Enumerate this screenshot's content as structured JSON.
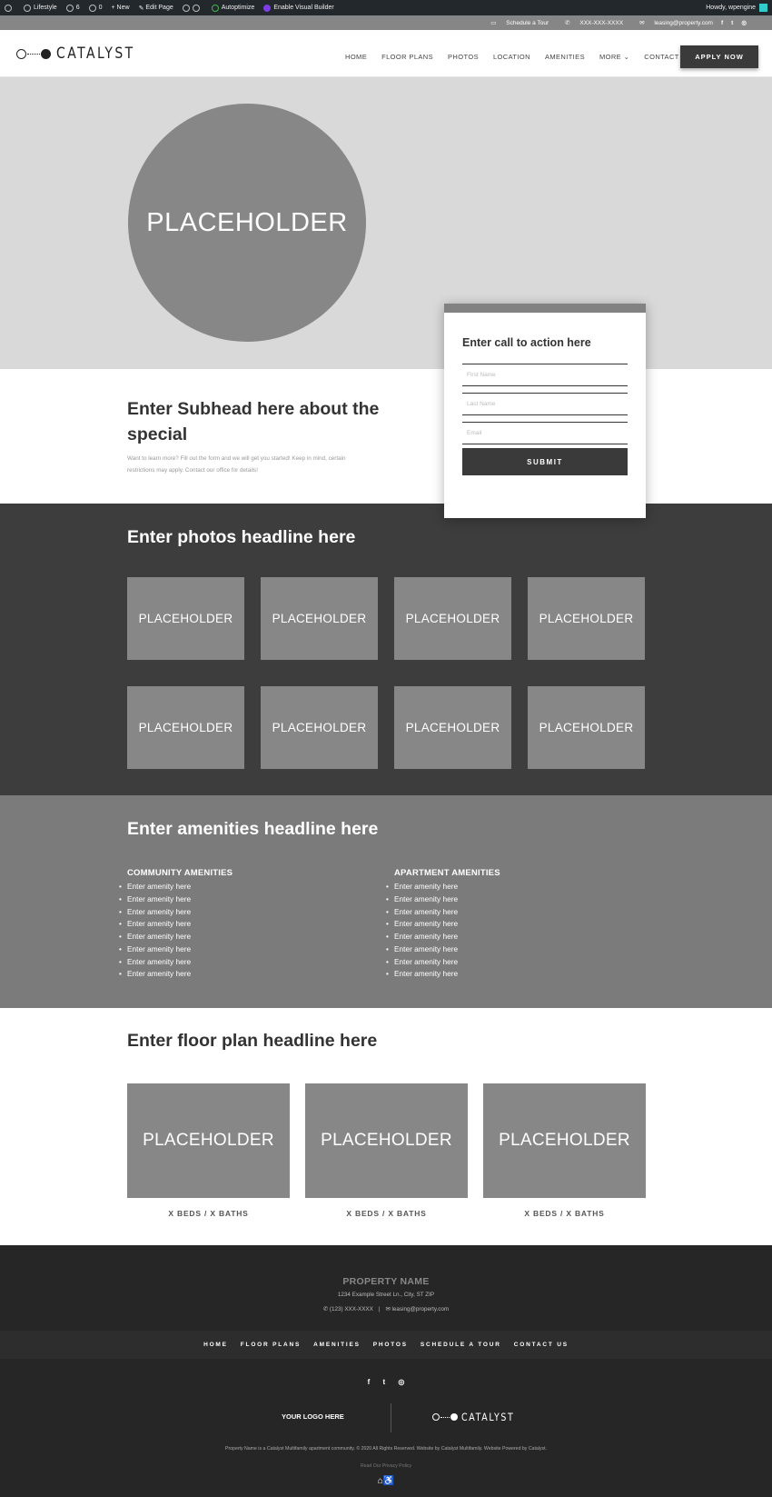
{
  "admin_bar": {
    "site": "Lifestyle",
    "updates": "6",
    "comments": "0",
    "new": "New",
    "edit_page": "Edit Page",
    "autoptimize": "Autoptimize",
    "visual_builder": "Enable Visual Builder",
    "howdy": "Howdy, wpengine"
  },
  "top_bar": {
    "schedule": "Schedule a Tour",
    "phone": "XXX-XXX-XXXX",
    "email": "leasing@property.com"
  },
  "header": {
    "logo_text": "CATALYST",
    "nav": [
      "HOME",
      "FLOOR PLANS",
      "PHOTOS",
      "LOCATION",
      "AMENITIES",
      "MORE ⌄",
      "CONTACT US"
    ],
    "apply_label": "APPLY NOW"
  },
  "hero": {
    "placeholder": "PLACEHOLDER"
  },
  "special": {
    "subhead": "Enter Subhead here about the special",
    "body": "Want to learn more? Fill out the form and we will get you started! Keep in mind, certain restrictions may apply. Contact our office for details!"
  },
  "cta": {
    "title": "Enter call to action here",
    "first_name_placeholder": "First Name",
    "last_name_placeholder": "Last Name",
    "email_placeholder": "Email",
    "submit_label": "SUBMIT"
  },
  "photos": {
    "headline": "Enter photos headline here",
    "items": [
      "PLACEHOLDER",
      "PLACEHOLDER",
      "PLACEHOLDER",
      "PLACEHOLDER",
      "PLACEHOLDER",
      "PLACEHOLDER",
      "PLACEHOLDER",
      "PLACEHOLDER"
    ]
  },
  "amenities": {
    "headline": "Enter amenities headline here",
    "community_title": "COMMUNITY AMENITIES",
    "apartment_title": "APARTMENT AMENITIES",
    "community": [
      "Enter amenity here",
      "Enter amenity here",
      "Enter amenity here",
      "Enter amenity here",
      "Enter amenity here",
      "Enter amenity here",
      "Enter amenity here",
      "Enter amenity here"
    ],
    "apartment": [
      "Enter amenity here",
      "Enter amenity here",
      "Enter amenity here",
      "Enter amenity here",
      "Enter amenity here",
      "Enter amenity here",
      "Enter amenity here",
      "Enter amenity here"
    ]
  },
  "floor_plans": {
    "headline": "Enter floor plan headline here",
    "items": [
      {
        "label": "PLACEHOLDER",
        "caption": "X BEDS / X BATHS"
      },
      {
        "label": "PLACEHOLDER",
        "caption": "X BEDS / X BATHS"
      },
      {
        "label": "PLACEHOLDER",
        "caption": "X BEDS / X BATHS"
      }
    ]
  },
  "footer": {
    "property_name": "PROPERTY NAME",
    "address": "1234 Example Street Ln., City, ST ZIP",
    "phone": "(123) XXX-XXXX",
    "email": "leasing@property.com",
    "nav": [
      "HOME",
      "FLOOR PLANS",
      "AMENITIES",
      "PHOTOS",
      "SCHEDULE A TOUR",
      "CONTACT US"
    ],
    "your_logo": "YOUR LOGO HERE",
    "catalyst_logo": "CATALYST",
    "legal": "Property Name is a Catalyst Multifamily apartment community. © 2020 All Rights Reserved. Website by Catalyst Multifamily. Website Powered by Catalyst.",
    "privacy": "Read Our Privacy Policy"
  }
}
